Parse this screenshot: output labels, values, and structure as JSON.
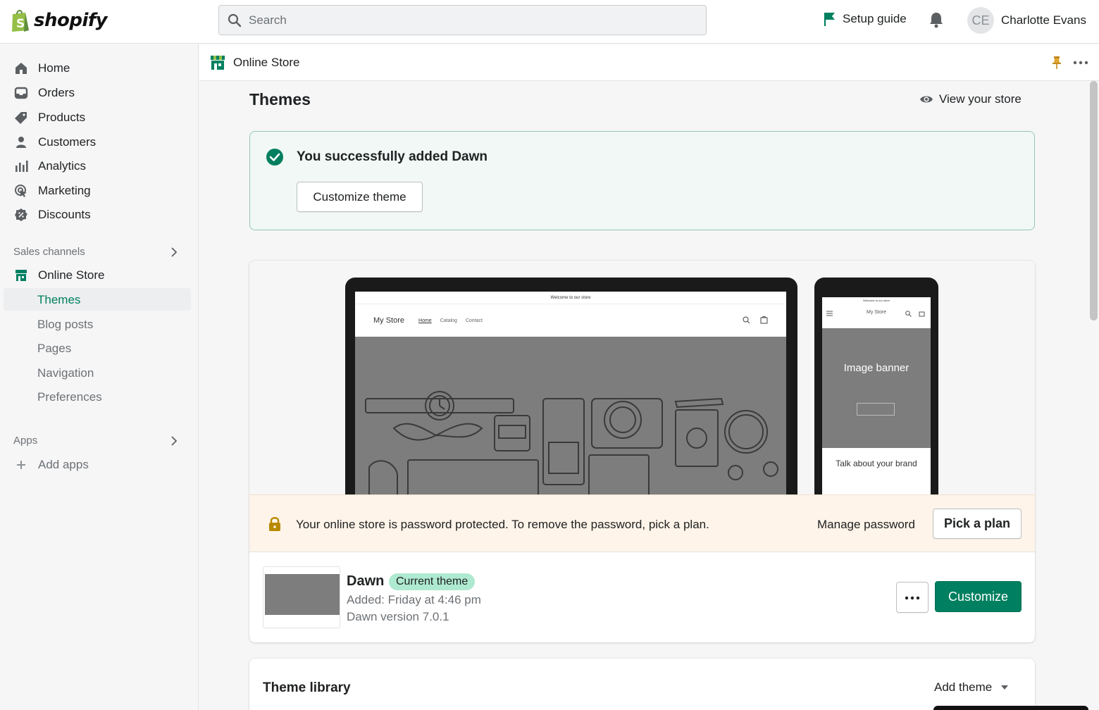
{
  "topbar": {
    "logo_text": "shopify",
    "search_placeholder": "Search",
    "setup_guide": "Setup guide",
    "user_initials": "CE",
    "user_name": "Charlotte Evans"
  },
  "sidebar": {
    "items": [
      {
        "label": "Home",
        "icon": "home-icon"
      },
      {
        "label": "Orders",
        "icon": "orders-icon"
      },
      {
        "label": "Products",
        "icon": "tag-icon"
      },
      {
        "label": "Customers",
        "icon": "person-icon"
      },
      {
        "label": "Analytics",
        "icon": "bar-chart-icon"
      },
      {
        "label": "Marketing",
        "icon": "target-icon"
      },
      {
        "label": "Discounts",
        "icon": "discount-icon"
      }
    ],
    "sales_channels_label": "Sales channels",
    "online_store_label": "Online Store",
    "sub_items": [
      "Themes",
      "Blog posts",
      "Pages",
      "Navigation",
      "Preferences"
    ],
    "apps_label": "Apps",
    "add_apps": "Add apps"
  },
  "header": {
    "breadcrumb": "Online Store"
  },
  "page": {
    "title": "Themes",
    "view_store": "View your store"
  },
  "banner": {
    "message": "You successfully added Dawn",
    "button": "Customize theme"
  },
  "preview": {
    "laptop_announcement": "Welcome to our store",
    "laptop_store": "My Store",
    "laptop_nav": [
      "Home",
      "Catalog",
      "Contact"
    ],
    "phone_announcement": "Welcome to our store",
    "phone_store": "My Store",
    "phone_banner_heading": "Image banner",
    "phone_brand": "Talk about your brand"
  },
  "warning": {
    "message": "Your online store is password protected. To remove the password, pick a plan.",
    "manage": "Manage password",
    "pick_plan": "Pick a plan"
  },
  "theme": {
    "name": "Dawn",
    "badge": "Current theme",
    "added": "Added: Friday at 4:46 pm",
    "version": "Dawn version 7.0.1",
    "more": "•••",
    "customize": "Customize"
  },
  "library": {
    "title": "Theme library",
    "add_theme": "Add theme"
  },
  "colors": {
    "primary": "#008060",
    "success_bg": "#f1f8f5",
    "warning_bg": "#fff4e9",
    "badge_bg": "#aee9d1"
  }
}
